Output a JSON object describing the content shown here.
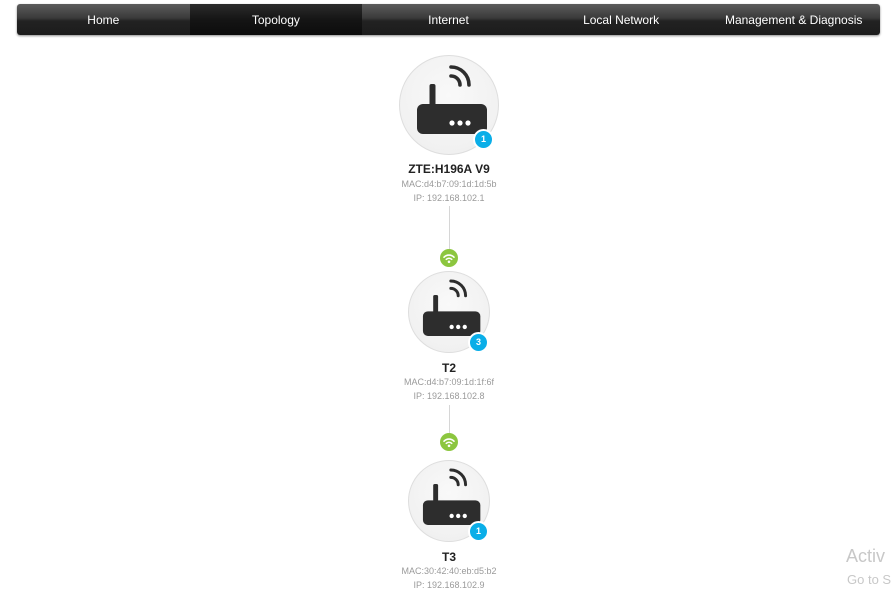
{
  "nav": {
    "items": [
      {
        "label": "Home",
        "active": false
      },
      {
        "label": "Topology",
        "active": true
      },
      {
        "label": "Internet",
        "active": false
      },
      {
        "label": "Local Network",
        "active": false
      },
      {
        "label": "Management & Diagnosis",
        "active": false
      }
    ]
  },
  "topology": {
    "nodes": [
      {
        "name": "ZTE:H196A V9",
        "mac": "MAC:d4:b7:09:1d:1d:5b",
        "ip": "IP: 192.168.102.1",
        "badge": "1",
        "icon": "router-icon"
      },
      {
        "name": "T2",
        "mac": "MAC:d4:b7:09:1d:1f:6f",
        "ip": "IP: 192.168.102.8",
        "badge": "3",
        "icon": "router-icon"
      },
      {
        "name": "T3",
        "mac": "MAC:30:42:40:eb:d5:b2",
        "ip": "IP: 192.168.102.9",
        "badge": "1",
        "icon": "router-icon"
      }
    ],
    "links": [
      {
        "type": "wifi",
        "icon": "wifi-icon"
      },
      {
        "type": "wifi",
        "icon": "wifi-icon"
      }
    ]
  },
  "watermark": {
    "line1": "Activ",
    "line2": "Go to S"
  },
  "colors": {
    "badge": "#0aaee8",
    "wifi": "#8cc63f",
    "router": "#2d2d2d"
  }
}
